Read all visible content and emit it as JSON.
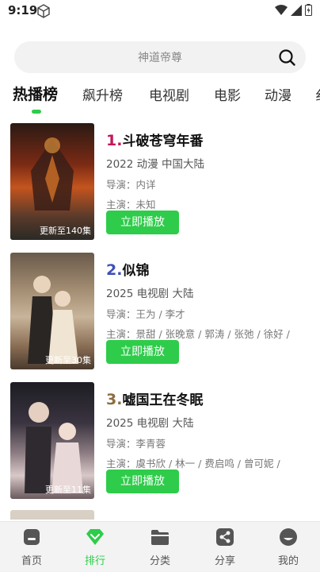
{
  "status": {
    "time": "9:19"
  },
  "search": {
    "placeholder": "神道帝尊"
  },
  "tabs": [
    {
      "label": "热播榜"
    },
    {
      "label": "飙升榜"
    },
    {
      "label": "电视剧"
    },
    {
      "label": "电影"
    },
    {
      "label": "动漫"
    },
    {
      "label": "纟"
    }
  ],
  "items": [
    {
      "rank": "1.",
      "title": "斗破苍穹年番",
      "meta": "2022  动漫  中国大陆",
      "director": "导演：内详",
      "cast": "主演：未知",
      "badge": "更新至140集",
      "play_label": "立即播放",
      "rank_color": "#c2185b"
    },
    {
      "rank": "2.",
      "title": "似锦",
      "meta": "2025  电视剧  大陆",
      "director": "导演：王为 / 李才",
      "cast": "主演：景甜 / 张晚意 / 郭涛 / 张弛 / 徐好 /",
      "badge": "更新至30集",
      "play_label": "立即播放",
      "rank_color": "#3f51b5"
    },
    {
      "rank": "3.",
      "title": "嘘国王在冬眠",
      "meta": "2025  电视剧  大陆",
      "director": "导演：李青蓉",
      "cast": "主演：虞书欣 / 林一 / 费启鸣 / 曾可妮 /",
      "badge": "更新至11集",
      "play_label": "立即播放",
      "rank_color": "#8d6e3f"
    }
  ],
  "nav": [
    {
      "label": "首页"
    },
    {
      "label": "排行"
    },
    {
      "label": "分类"
    },
    {
      "label": "分享"
    },
    {
      "label": "我的"
    }
  ],
  "colors": {
    "accent": "#2ecc4a",
    "rank1": "#c2185b",
    "rank2": "#3f51b5",
    "rank3": "#8d6e3f"
  }
}
